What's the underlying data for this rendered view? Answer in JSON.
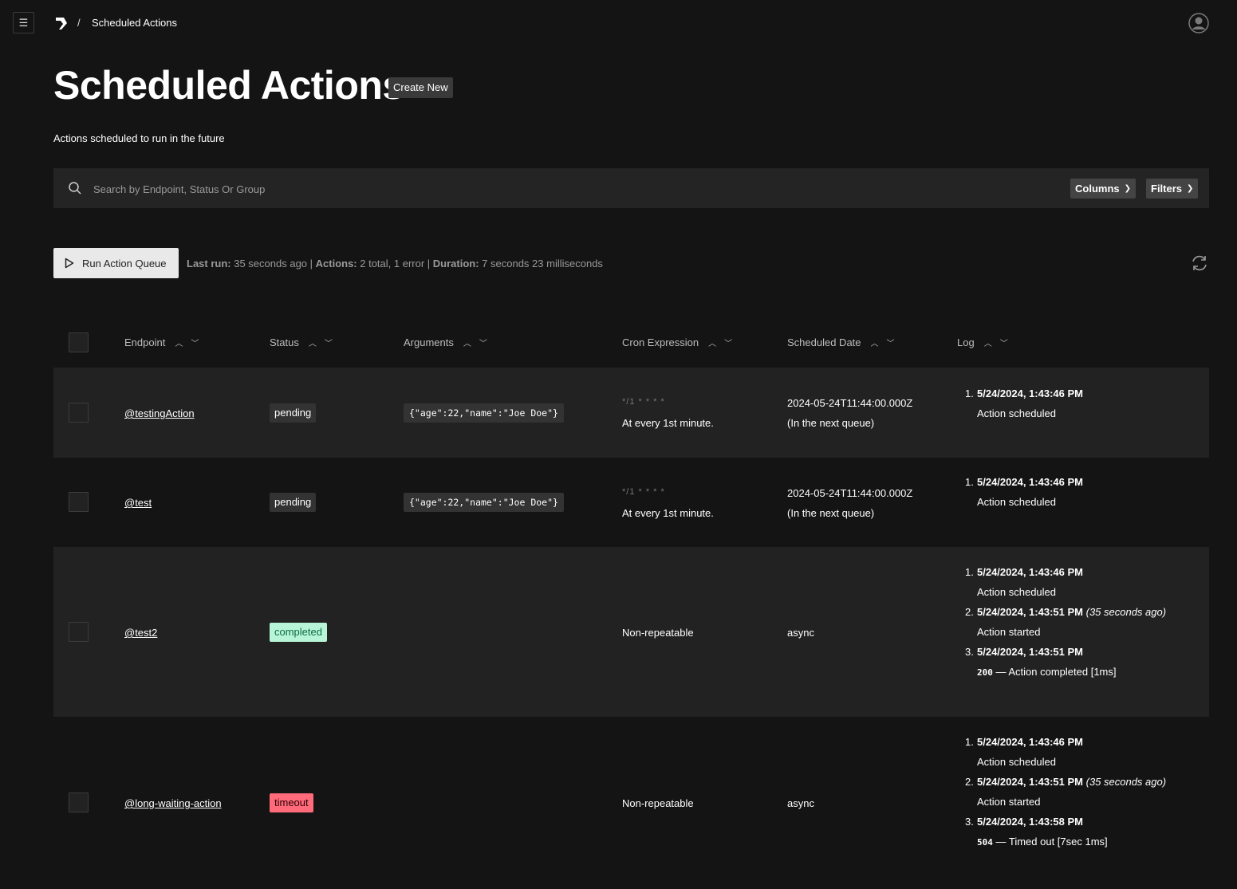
{
  "nav": {
    "menu_icon": "menu-icon",
    "breadcrumb_sep": "/",
    "breadcrumb_current": "Scheduled Actions"
  },
  "header": {
    "title": "Scheduled Actions",
    "create_label": "Create New",
    "subtitle": "Actions scheduled to run in the future"
  },
  "search": {
    "placeholder": "Search by Endpoint, Status Or Group",
    "columns_label": "Columns",
    "filters_label": "Filters"
  },
  "queue": {
    "run_label": "Run Action Queue",
    "last_run_label": "Last run:",
    "last_run_value": " 35 seconds ago | ",
    "actions_label": "Actions:",
    "actions_value": " 2 total, 1 error | ",
    "duration_label": "Duration:",
    "duration_value": " 7 seconds 23 milliseconds"
  },
  "table": {
    "columns": [
      "Endpoint",
      "Status",
      "Arguments",
      "Cron Expression",
      "Scheduled Date",
      "Log"
    ],
    "rows": [
      {
        "endpoint": "@testingAction",
        "status": "pending",
        "args": "{\"age\":22,\"name\":\"Joe Doe\"}",
        "cron": "*/1 * * * *",
        "cron_desc": "At every 1st minute.",
        "date": "2024-05-24T11:44:00.000Z",
        "date_note": "(In the next queue)",
        "log": [
          {
            "n": "1.",
            "ts": "5/24/2024, 1:43:46 PM",
            "ago": "",
            "code": "",
            "msg": "Action scheduled"
          }
        ]
      },
      {
        "endpoint": "@test",
        "status": "pending",
        "args": "{\"age\":22,\"name\":\"Joe Doe\"}",
        "cron": "*/1 * * * *",
        "cron_desc": "At every 1st minute.",
        "date": "2024-05-24T11:44:00.000Z",
        "date_note": "(In the next queue)",
        "log": [
          {
            "n": "1.",
            "ts": "5/24/2024, 1:43:46 PM",
            "ago": "",
            "code": "",
            "msg": "Action scheduled"
          }
        ]
      },
      {
        "endpoint": "@test2",
        "status": "completed",
        "cron_desc": "Non-repeatable",
        "date": "async",
        "log": [
          {
            "n": "1.",
            "ts": "5/24/2024, 1:43:46 PM",
            "ago": "",
            "code": "",
            "msg": "Action scheduled"
          },
          {
            "n": "2.",
            "ts": "5/24/2024, 1:43:51 PM",
            "ago": "(35 seconds ago)",
            "code": "",
            "msg": "Action started"
          },
          {
            "n": "3.",
            "ts": "5/24/2024, 1:43:51 PM",
            "ago": "",
            "code": "200",
            "msg": " — Action completed [1ms]"
          }
        ]
      },
      {
        "endpoint": "@long-waiting-action",
        "status": "timeout",
        "cron_desc": "Non-repeatable",
        "date": "async",
        "log": [
          {
            "n": "1.",
            "ts": "5/24/2024, 1:43:46 PM",
            "ago": "",
            "code": "",
            "msg": "Action scheduled"
          },
          {
            "n": "2.",
            "ts": "5/24/2024, 1:43:51 PM",
            "ago": "(35 seconds ago)",
            "code": "",
            "msg": "Action started"
          },
          {
            "n": "3.",
            "ts": "5/24/2024, 1:43:58 PM",
            "ago": "",
            "code": "504",
            "msg": " — Timed out [7sec 1ms]"
          }
        ]
      }
    ]
  },
  "colors": {
    "background": "#141414",
    "row_alt": "#222222",
    "completed_bg": "#b7f5d6",
    "timeout_bg": "#ff6b7a"
  }
}
